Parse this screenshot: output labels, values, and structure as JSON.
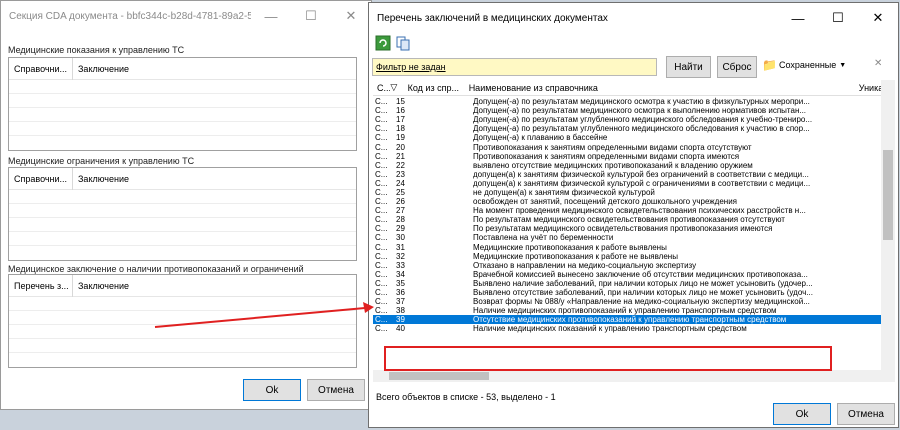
{
  "window1": {
    "title": "Секция CDA документа - bbfc344c-b28d-4781-89a2-5f8071...",
    "section1_label": "Медицинские показания к управлению ТС",
    "section2_label": "Медицинские ограничения к управлению ТС",
    "section3_label": "Медицинское заключение о наличии противопоказаний и ограничений",
    "grid1_cols": [
      "Справочни...",
      "Заключение"
    ],
    "grid2_cols": [
      "Справочни...",
      "Заключение"
    ],
    "grid3_cols": [
      "Перечень з...",
      "Заключение"
    ],
    "ok_label": "Ok",
    "cancel_label": "Отмена"
  },
  "window2": {
    "title": "Перечень заключений в медицинских документах",
    "filter_text": "Фильтр не задан",
    "find_label": "Найти",
    "reset_label": "Сброс",
    "saved_label": "Сохраненные",
    "columns": [
      "С...",
      "Код из спр...",
      "Наименование из справочника",
      "Уникальн"
    ],
    "rows": [
      {
        "c": "С...",
        "code": "15",
        "name": "Допущен(-а) по результатам медицинского осмотра к участию в физкультурных меропри..."
      },
      {
        "c": "С...",
        "code": "16",
        "name": "Допущен(-а) по результатам медицинского осмотра к выполнению нормативов испытан..."
      },
      {
        "c": "С...",
        "code": "17",
        "name": "Допущен(-а) по результатам углубленного медицинского обследования к учебно-трениро..."
      },
      {
        "c": "С...",
        "code": "18",
        "name": "Допущен(-а) по результатам углубленного медицинского обследования к участию в спор..."
      },
      {
        "c": "С...",
        "code": "19",
        "name": "Допущен(-а) к плаванию в бассейне"
      },
      {
        "c": "С...",
        "code": "20",
        "name": "Противопоказания к занятиям определенными видами спорта отсутствуют"
      },
      {
        "c": "С...",
        "code": "21",
        "name": "Противопоказания к занятиям определенными видами спорта имеются"
      },
      {
        "c": "С...",
        "code": "22",
        "name": "выявлено отсутствие медицинских противопоказаний к владению оружием"
      },
      {
        "c": "С...",
        "code": "23",
        "name": "допущен(а) к занятиям физической культурой без ограничений в соответствии с медици..."
      },
      {
        "c": "С...",
        "code": "24",
        "name": "допущен(а) к занятиям физической культурой с ограничениями в соответствии с медици..."
      },
      {
        "c": "С...",
        "code": "25",
        "name": "не допущен(а) к занятиям физической культурой"
      },
      {
        "c": "С...",
        "code": "26",
        "name": "освобожден от занятий, посещений детского дошкольного учреждения"
      },
      {
        "c": "С...",
        "code": "27",
        "name": "На момент проведения медицинского освидетельствования психических расстройств н..."
      },
      {
        "c": "С...",
        "code": "28",
        "name": "По результатам медицинского освидетельствования противопоказания отсутствуют"
      },
      {
        "c": "С...",
        "code": "29",
        "name": "По результатам медицинского освидетельствования противопоказания имеются"
      },
      {
        "c": "С...",
        "code": "30",
        "name": "Поставлена на учёт по беременности"
      },
      {
        "c": "С...",
        "code": "31",
        "name": "Медицинские противопоказания к работе выявлены"
      },
      {
        "c": "С...",
        "code": "32",
        "name": "Медицинские противопоказания к работе не выявлены"
      },
      {
        "c": "С...",
        "code": "33",
        "name": "Отказано в направлении на медико-социальную экспертизу"
      },
      {
        "c": "С...",
        "code": "34",
        "name": "Врачебной комиссией вынесено заключение об отсутствии медицинских противопоказа..."
      },
      {
        "c": "С...",
        "code": "35",
        "name": "Выявлено наличие заболеваний, при наличии которых лицо не может усыновить (удочер..."
      },
      {
        "c": "С...",
        "code": "36",
        "name": "Выявлено отсутствие заболеваний, при наличии которых лицо не может усыновить (удоч..."
      },
      {
        "c": "С...",
        "code": "37",
        "name": "Возврат формы № 088/у «Направление на медико-социальную экспертизу медицинской..."
      },
      {
        "c": "С...",
        "code": "38",
        "name": "Наличие медицинских противопоказаний к управлению транспортным средством"
      },
      {
        "c": "С...",
        "code": "39",
        "name": "Отсутствие медицинских противопоказаний к управлению транспортным средством"
      },
      {
        "c": "С...",
        "code": "40",
        "name": "Наличие медицинских показаний к управлению транспортным средством"
      }
    ],
    "status_text": "Всего объектов в списке - 53, выделено - 1",
    "ok_label": "Ok",
    "cancel_label": "Отмена"
  },
  "colors": {
    "selection": "#0078d7",
    "highlight": "#e02020",
    "filter_bg": "#fff9c4"
  }
}
